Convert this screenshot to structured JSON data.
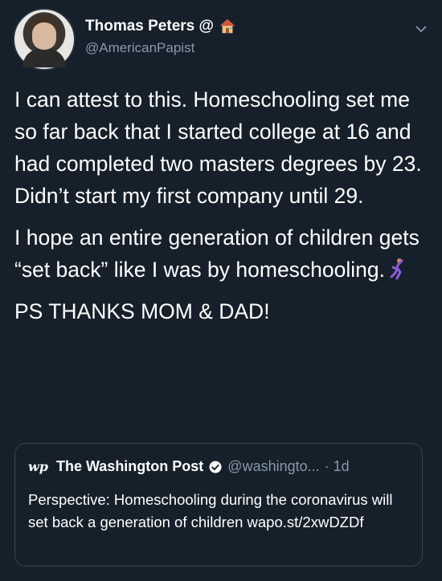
{
  "tweet": {
    "author_name": "Thomas Peters @",
    "author_handle": "@AmericanPapist",
    "paragraphs": [
      "I can attest to this. Homeschooling set me so far back that I started college at 16 and had completed two masters degrees by 23. Didn’t start my first company until 29.",
      "I hope an entire generation of children gets “set back” like I was by homeschooling.",
      "PS THANKS MOM & DAD!"
    ],
    "name_emoji": "house-icon",
    "inline_emoji": "dancer-icon"
  },
  "quoted": {
    "logo": "wp",
    "name": "The Washington Post",
    "handle": "@washingto...",
    "time": "· 1d",
    "text": "Perspective: Homeschooling during the coronavirus will set back a generation of children wapo.st/2xwDZDf"
  },
  "colors": {
    "background": "#15202b",
    "text": "#ffffff",
    "secondary": "#8899a6",
    "verified": "#ffffff",
    "border": "#38444d"
  }
}
